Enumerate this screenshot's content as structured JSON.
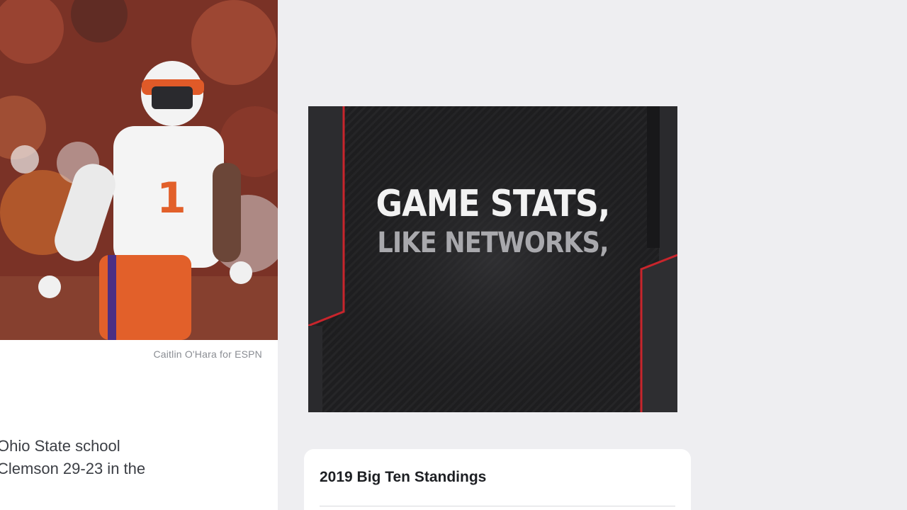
{
  "article": {
    "photo_alt": "Clemson player in white and orange uniform celebrating on field",
    "photo_credit": "Caitlin O'Hara for ESPN",
    "body_lines": [
      "Ohio State school",
      "Clemson 29-23 in the"
    ]
  },
  "promo": {
    "line1": "GAME STATS,",
    "line2": "LIKE NETWORKS,"
  },
  "standings": {
    "title": "2019 Big Ten Standings"
  },
  "colors": {
    "page_bg": "#eeeef1",
    "card_bg": "#ffffff",
    "promo_red": "#c8252c",
    "clemson_orange": "#e2602a"
  }
}
